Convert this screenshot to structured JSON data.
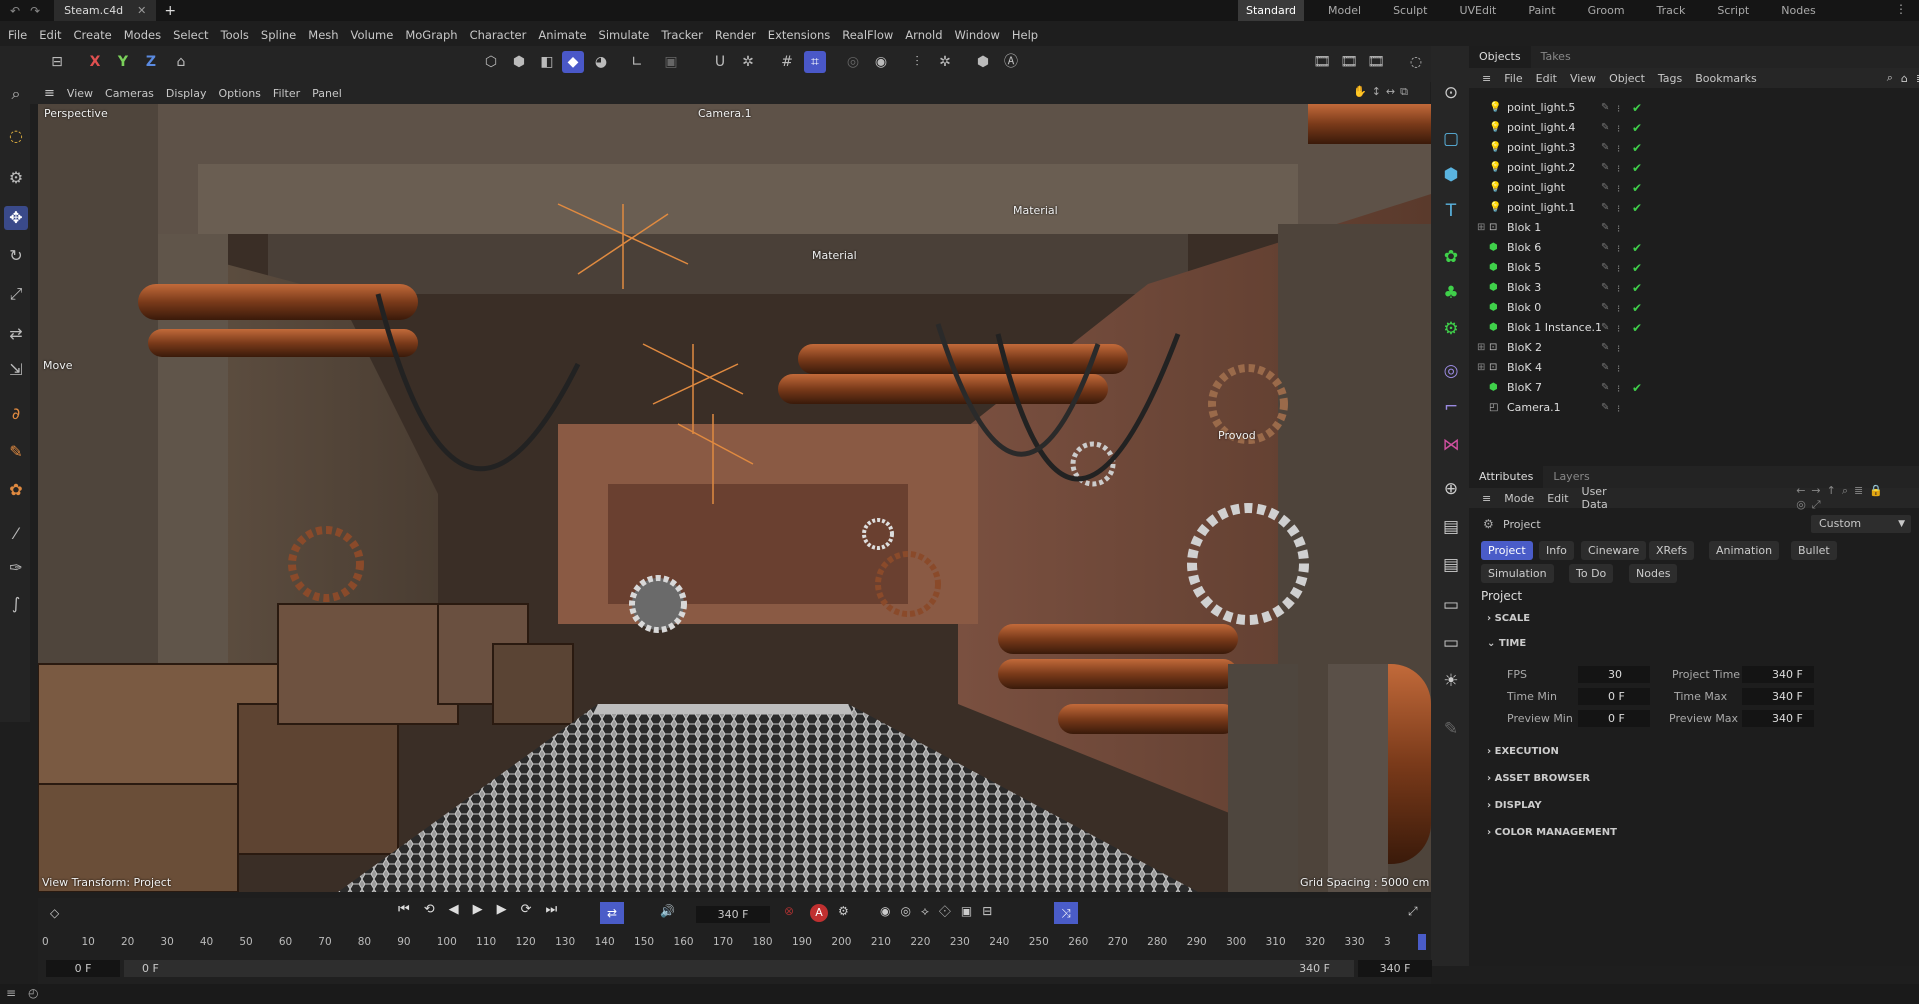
{
  "window": {
    "doc_tab": "Steam.c4d"
  },
  "layouts": [
    "Standard",
    "Model",
    "Sculpt",
    "UVEdit",
    "Paint",
    "Groom",
    "Track",
    "Script",
    "Nodes"
  ],
  "menus": [
    "File",
    "Edit",
    "Create",
    "Modes",
    "Select",
    "Tools",
    "Spline",
    "Mesh",
    "Volume",
    "MoGraph",
    "Character",
    "Animate",
    "Simulate",
    "Tracker",
    "Render",
    "Extensions",
    "RealFlow",
    "Arnold",
    "Window",
    "Help"
  ],
  "axis_toggles": [
    "X",
    "Y",
    "Z"
  ],
  "viewport_menu": [
    "View",
    "Cameras",
    "Display",
    "Options",
    "Filter",
    "Panel"
  ],
  "viewport": {
    "mode": "Perspective",
    "camera": "Camera.1",
    "tool": "Move",
    "view_transform": "View Transform: Project",
    "grid_spacing": "Grid Spacing : 5000 cm",
    "labels": [
      "Material",
      "Material",
      "Provod"
    ]
  },
  "objects_panel": {
    "tabs": [
      "Objects",
      "Takes"
    ],
    "menu": [
      "File",
      "Edit",
      "View",
      "Object",
      "Tags",
      "Bookmarks"
    ],
    "rows": [
      {
        "name": "point_light.5",
        "type": "light",
        "checked": true
      },
      {
        "name": "point_light.4",
        "type": "light",
        "checked": true
      },
      {
        "name": "point_light.3",
        "type": "light",
        "checked": true
      },
      {
        "name": "point_light.2",
        "type": "light",
        "checked": true
      },
      {
        "name": "point_light",
        "type": "light",
        "checked": true
      },
      {
        "name": "point_light.1",
        "type": "light",
        "checked": true
      },
      {
        "name": "Blok 1",
        "type": "group",
        "checked": false
      },
      {
        "name": "Blok  6",
        "type": "mesh",
        "checked": true
      },
      {
        "name": "Blok  5",
        "type": "mesh",
        "checked": true
      },
      {
        "name": "Blok 3",
        "type": "mesh",
        "checked": true
      },
      {
        "name": "Blok 0",
        "type": "mesh",
        "checked": true
      },
      {
        "name": "Blok 1 Instance.1",
        "type": "mesh",
        "checked": true
      },
      {
        "name": "BloK 2",
        "type": "group",
        "checked": false
      },
      {
        "name": "BloK  4",
        "type": "group",
        "checked": false
      },
      {
        "name": "BloK 7",
        "type": "mesh",
        "checked": true
      },
      {
        "name": "Camera.1",
        "type": "camera",
        "checked": false
      }
    ]
  },
  "attributes_panel": {
    "tabs": [
      "Attributes",
      "Layers"
    ],
    "menu": [
      "Mode",
      "Edit",
      "User Data"
    ],
    "object": "Project",
    "preset": "Custom",
    "buttons": [
      "Project",
      "Info",
      "Cineware",
      "XRefs",
      "Animation",
      "Bullet",
      "Simulation",
      "To Do",
      "Nodes"
    ],
    "heading": "Project",
    "sections": [
      "SCALE",
      "TIME",
      "EXECUTION",
      "ASSET BROWSER",
      "DISPLAY",
      "COLOR MANAGEMENT"
    ],
    "time_fields": [
      {
        "label": "FPS",
        "value": "30"
      },
      {
        "label": "Project Time",
        "value": "340 F"
      },
      {
        "label": "Time Min",
        "value": "0 F"
      },
      {
        "label": "Time Max",
        "value": "340 F"
      },
      {
        "label": "Preview Min",
        "value": "0 F"
      },
      {
        "label": "Preview Max",
        "value": "340 F"
      }
    ]
  },
  "timeline": {
    "current_frame": "340 F",
    "ticks": [
      "0",
      "10",
      "20",
      "30",
      "40",
      "50",
      "60",
      "70",
      "80",
      "90",
      "100",
      "110",
      "120",
      "130",
      "140",
      "150",
      "160",
      "170",
      "180",
      "190",
      "200",
      "210",
      "220",
      "230",
      "240",
      "250",
      "260",
      "270",
      "280",
      "290",
      "300",
      "310",
      "320",
      "330",
      "3"
    ],
    "range_start": "0 F",
    "range_start2": "0 F",
    "range_end": "340 F",
    "range_end2": "340 F"
  },
  "colors": {
    "accent": "#4a5cc8",
    "check": "#3fd04a",
    "icon_blue": "#5ab4e0"
  }
}
